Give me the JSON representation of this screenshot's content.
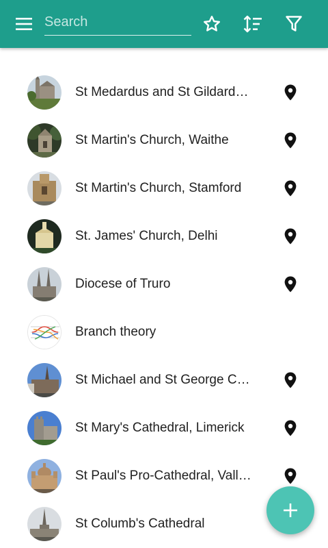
{
  "toolbar": {
    "menu_icon": "menu-icon",
    "search_placeholder": "Search",
    "search_value": "",
    "favorites_icon": "star-outline-icon",
    "sort_icon": "sort-icon",
    "filter_icon": "filter-icon",
    "background_color": "#1e9e8c"
  },
  "items": [
    {
      "label": "St Medardus and St Gildard…",
      "has_location": true,
      "thumb_icon": "church-photo"
    },
    {
      "label": "St Martin's Church, Waithe",
      "has_location": true,
      "thumb_icon": "church-photo"
    },
    {
      "label": "St Martin's Church, Stamford",
      "has_location": true,
      "thumb_icon": "church-photo"
    },
    {
      "label": "St. James' Church, Delhi",
      "has_location": true,
      "thumb_icon": "church-photo"
    },
    {
      "label": "Diocese of Truro",
      "has_location": true,
      "thumb_icon": "cathedral-photo"
    },
    {
      "label": "Branch theory",
      "has_location": false,
      "thumb_icon": "diagram-image"
    },
    {
      "label": "St Michael and St George C…",
      "has_location": true,
      "thumb_icon": "cathedral-photo"
    },
    {
      "label": "St Mary's Cathedral, Limerick",
      "has_location": true,
      "thumb_icon": "cathedral-photo"
    },
    {
      "label": "St Paul's Pro-Cathedral, Vall…",
      "has_location": true,
      "thumb_icon": "cathedral-photo"
    },
    {
      "label": "St Columb's Cathedral",
      "has_location": false,
      "thumb_icon": "cathedral-photo"
    }
  ],
  "fab": {
    "icon": "plus-icon",
    "color": "#4dc4b4"
  }
}
